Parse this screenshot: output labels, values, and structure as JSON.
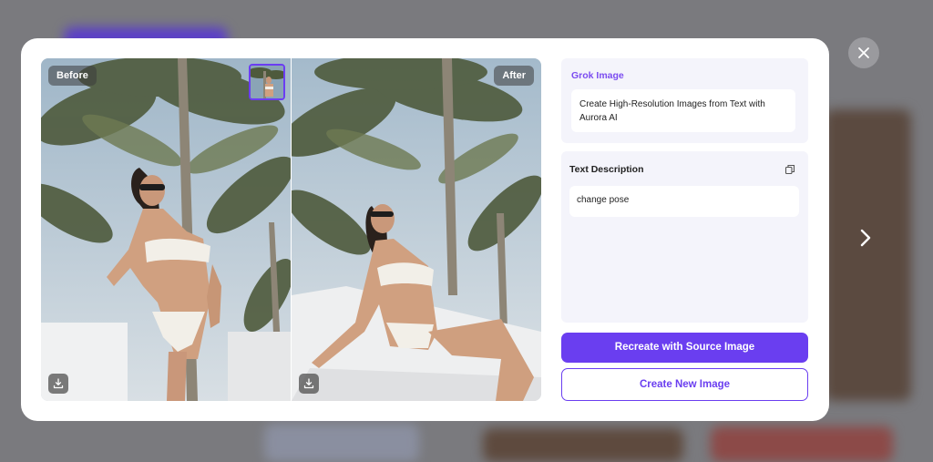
{
  "compare": {
    "before_label": "Before",
    "after_label": "After"
  },
  "info": {
    "title": "Grok Image",
    "description": "Create High-Resolution Images from Text with Aurora AI"
  },
  "text_description": {
    "label": "Text Description",
    "prompt": "change pose"
  },
  "actions": {
    "recreate_label": "Recreate with Source Image",
    "create_new_label": "Create New Image"
  },
  "colors": {
    "accent": "#6a3ef0",
    "accent_text": "#7b4cf0",
    "panel_bg": "#f4f4fb"
  },
  "icons": {
    "close": "close-icon",
    "next": "chevron-right-icon",
    "download": "download-icon",
    "copy": "copy-icon"
  }
}
